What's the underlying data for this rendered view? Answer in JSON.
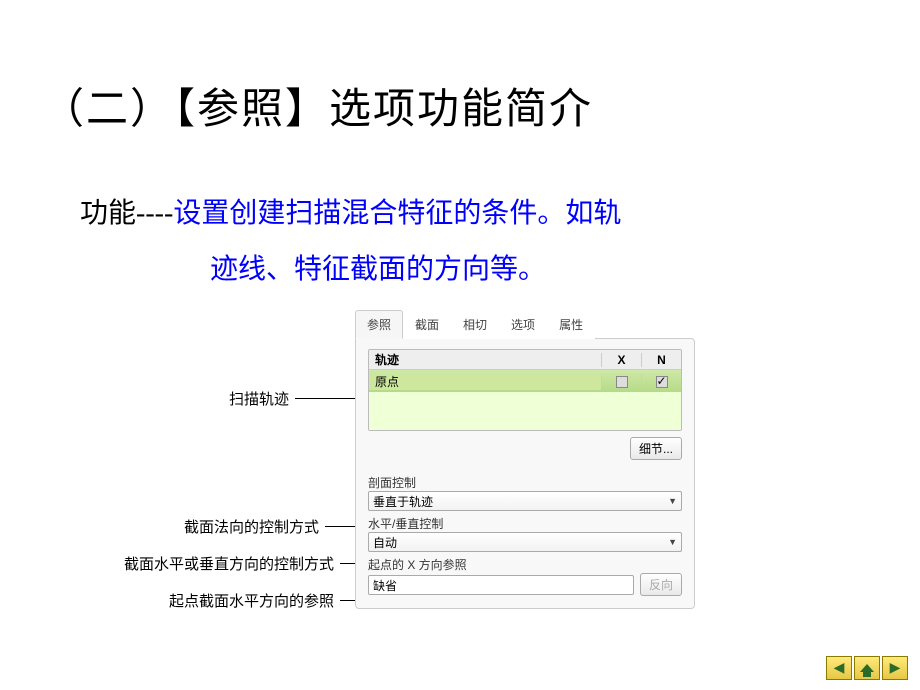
{
  "title": "（二）【参照】选项功能简介",
  "desc": {
    "lead": "功能----",
    "blue1": "设置创建扫描混合特征的条件。如轨",
    "blue2": "迹线、特征截面的方向等。"
  },
  "tabs": {
    "t0": "参照",
    "t1": "截面",
    "t2": "相切",
    "t3": "选项",
    "t4": "属性"
  },
  "track": {
    "header_name": "轨迹",
    "header_x": "X",
    "header_n": "N",
    "row0_name": "原点"
  },
  "buttons": {
    "detail": "细节...",
    "reverse": "反向"
  },
  "fields": {
    "section_ctrl_label": "剖面控制",
    "section_ctrl_value": "垂直于轨迹",
    "hv_ctrl_label": "水平/垂直控制",
    "hv_ctrl_value": "自动",
    "startpt_label": "起点的 X 方向参照",
    "startpt_value": "缺省"
  },
  "callouts": {
    "c0": "扫描轨迹",
    "c1": "截面法向的控制方式",
    "c2": "截面水平或垂直方向的控制方式",
    "c3": "起点截面水平方向的参照"
  }
}
